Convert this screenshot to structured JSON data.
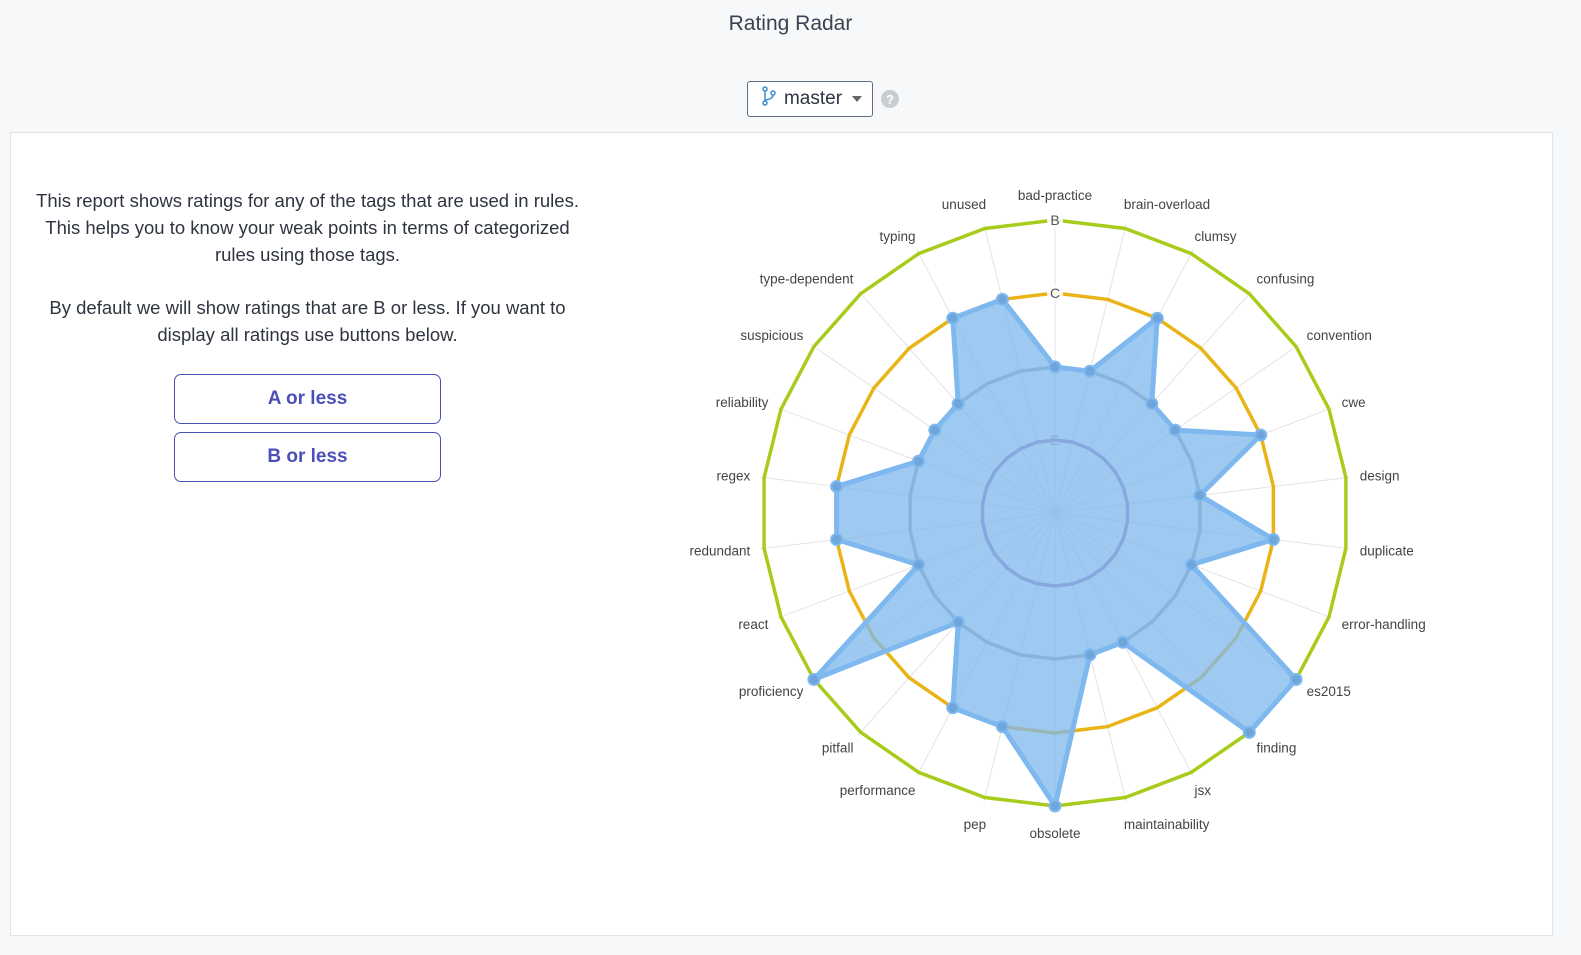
{
  "page": {
    "title": "Rating Radar"
  },
  "branch": {
    "name": "master",
    "icon": "git-branch-icon",
    "help_icon": "?"
  },
  "description": {
    "p1": "This report shows ratings for any of the tags that are used in rules. This helps you to know your weak points in terms of categorized rules using those tags.",
    "p2": "By default we will show ratings that are B or less. If you want to display all ratings use buttons below."
  },
  "buttons": {
    "a_or_less": "A or less",
    "b_or_less": "B or less"
  },
  "colors": {
    "accent": "#4b4fb8",
    "series": "#7eb8ee",
    "ring_B": "#a7cc1c",
    "ring_C": "#e9b418",
    "ring_D": "#a8a8a8",
    "ring_E": "#9c7ab0"
  },
  "chart_data": {
    "type": "radar",
    "scale": [
      "E",
      "D",
      "C",
      "B"
    ],
    "ring_labels": {
      "B": "B",
      "C": "C",
      "E": "E"
    },
    "categories": [
      "bad-practice",
      "brain-overload",
      "clumsy",
      "confusing",
      "convention",
      "cwe",
      "design",
      "duplicate",
      "error-handling",
      "es2015",
      "finding",
      "jsx",
      "maintainability",
      "obsolete",
      "pep",
      "performance",
      "pitfall",
      "proficiency",
      "react",
      "redundant",
      "regex",
      "reliability",
      "suspicious",
      "type-dependent",
      "typing",
      "unused"
    ],
    "series": [
      {
        "values": [
          "D",
          "D",
          "C",
          "D",
          "D",
          "C",
          "D",
          "C",
          "D",
          "B",
          "B",
          "D",
          "D",
          "B",
          "C",
          "C",
          "D",
          "B",
          "D",
          "C",
          "C",
          "D",
          "D",
          "D",
          "C",
          "C"
        ]
      }
    ]
  }
}
